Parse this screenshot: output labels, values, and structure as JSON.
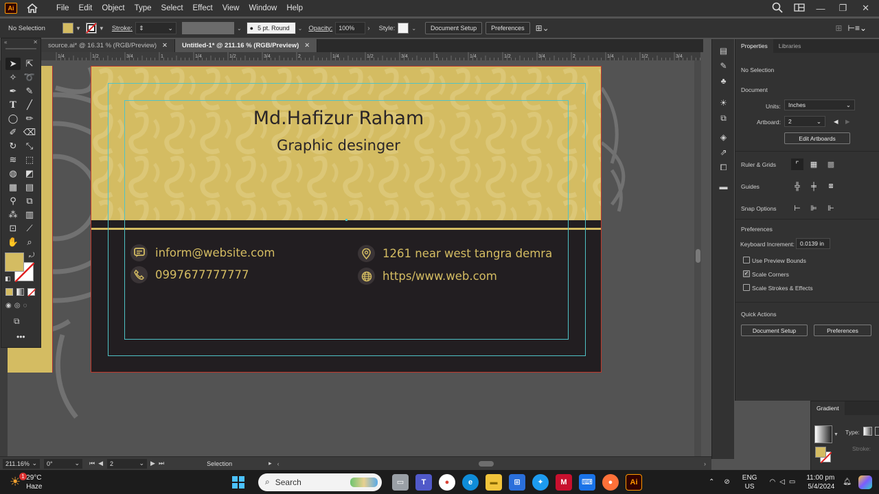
{
  "app": {
    "logo": "Ai",
    "menu": [
      "File",
      "Edit",
      "Object",
      "Type",
      "Select",
      "Effect",
      "View",
      "Window",
      "Help"
    ]
  },
  "control_bar": {
    "selection": "No Selection",
    "stroke_label": "Stroke:",
    "brush": "5 pt. Round",
    "opacity_label": "Opacity:",
    "opacity_value": "100%",
    "style_label": "Style:",
    "document_setup": "Document Setup",
    "preferences": "Preferences",
    "fill_color": "#d4bc62"
  },
  "tabs": [
    {
      "label": "source.ai* @ 16.31 % (RGB/Preview)"
    },
    {
      "label": "Untitled-1* @ 211.16 % (RGB/Preview)"
    }
  ],
  "ruler_labels": [
    "1/4",
    "1/2",
    "3/4",
    "1",
    "1/4",
    "1/2",
    "3/4",
    "2",
    "1/4",
    "1/2",
    "3/4",
    "1",
    "1/4",
    "1/2",
    "3/4",
    "2",
    "1/4",
    "1/2",
    "3/4",
    "1"
  ],
  "card": {
    "name": "Md.Hafizur Raham",
    "role": "Graphic desinger",
    "email": "inform@website.com",
    "phone": "0997677777777",
    "address": "1261 near west tangra demra",
    "website": "https/www.web.com",
    "gold": "#d4bc62",
    "dark": "#221e21"
  },
  "properties": {
    "tabs": [
      "Properties",
      "Libraries"
    ],
    "no_selection": "No Selection",
    "document": "Document",
    "units_label": "Units:",
    "units_value": "Inches",
    "artboard_label": "Artboard:",
    "artboard_value": "2",
    "edit_artboards": "Edit Artboards",
    "ruler_grids": "Ruler & Grids",
    "guides": "Guides",
    "snap_options": "Snap Options",
    "preferences": "Preferences",
    "keyboard_increment_label": "Keyboard Increment:",
    "keyboard_increment_value": "0.0139 in",
    "use_preview_bounds": "Use Preview Bounds",
    "scale_corners": "Scale Corners",
    "scale_strokes": "Scale Strokes & Effects",
    "use_preview_bounds_checked": false,
    "scale_corners_checked": true,
    "scale_strokes_checked": false,
    "quick_actions": "Quick Actions",
    "qa_document_setup": "Document Setup",
    "qa_preferences": "Preferences"
  },
  "gradient_panel": {
    "title": "Gradient",
    "type_label": "Type:",
    "stroke_label": "Stroke:"
  },
  "status_bar": {
    "zoom": "211.16%",
    "rotation": "0°",
    "artboard": "2",
    "tool": "Selection"
  },
  "taskbar": {
    "weather_temp": "29°C",
    "weather_desc": "Haze",
    "weather_badge": "1",
    "search_placeholder": "Search",
    "lang": "ENG",
    "region": "US",
    "time": "11:00 pm",
    "date": "5/4/2024"
  }
}
